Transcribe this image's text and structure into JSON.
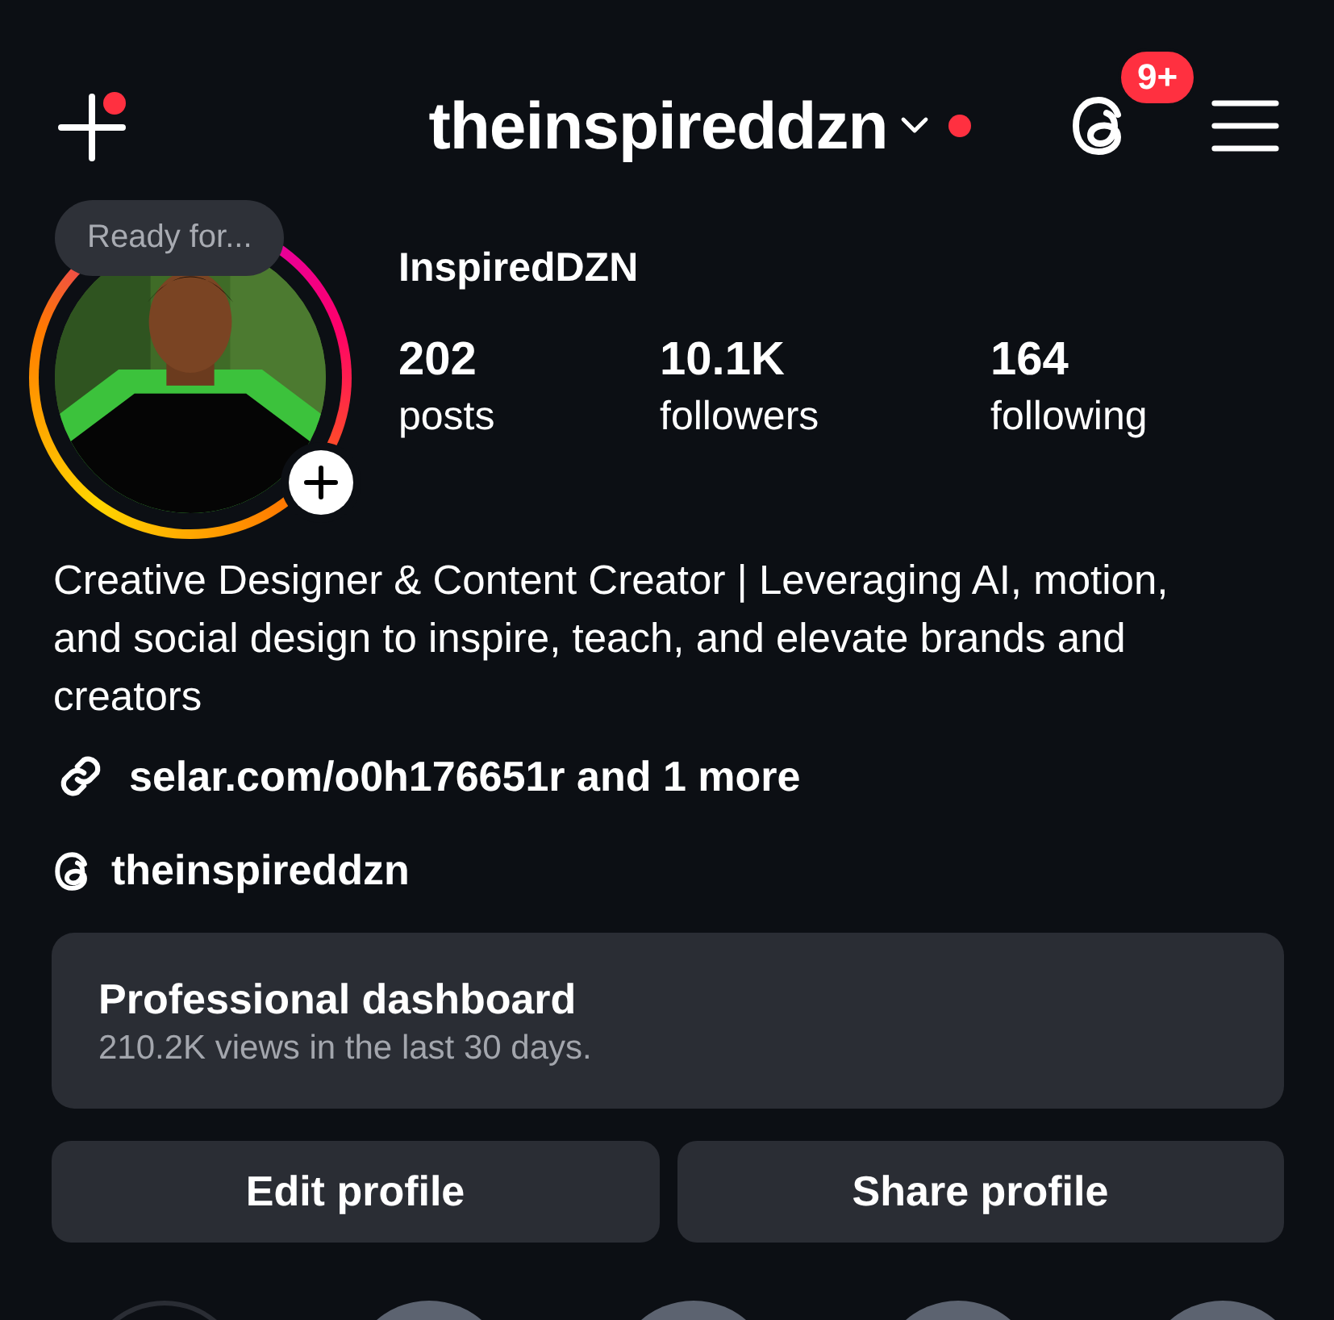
{
  "header": {
    "create_dot": true,
    "username": "theinspireddzn",
    "username_dot": true,
    "threads_badge": "9+"
  },
  "profile": {
    "story_ring": true,
    "note": "Ready for...",
    "display_name": "InspiredDZN",
    "stats": [
      {
        "value": "202",
        "label": "posts"
      },
      {
        "value": "10.1K",
        "label": "followers"
      },
      {
        "value": "164",
        "label": "following"
      }
    ],
    "bio": "Creative Designer & Content Creator | Leveraging AI, motion, and social design to inspire, teach, and elevate brands and creators",
    "link": "selar.com/o0h176651r and 1 more",
    "threads_handle": "theinspireddzn"
  },
  "dashboard": {
    "title": "Professional dashboard",
    "subtitle": "210.2K views in the last 30 days."
  },
  "buttons": [
    "Edit profile",
    "Share profile"
  ],
  "highlights": [
    {
      "kind": "new"
    },
    {
      "kind": "cover"
    },
    {
      "kind": "cover"
    },
    {
      "kind": "cover"
    },
    {
      "kind": "cover"
    }
  ]
}
